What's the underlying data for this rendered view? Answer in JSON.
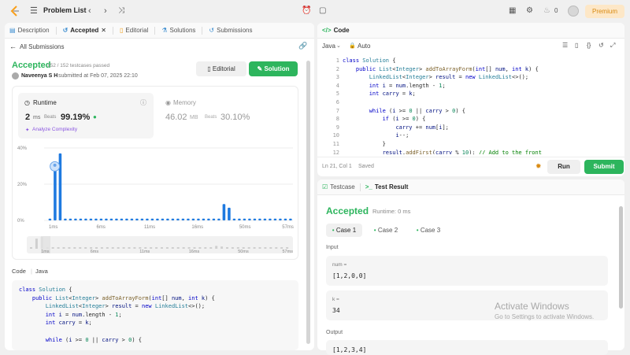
{
  "header": {
    "title": "Problem List",
    "premium": "Premium",
    "notifications": "0"
  },
  "left_tabs": [
    {
      "label": "Description"
    },
    {
      "label": "Accepted"
    },
    {
      "label": "Editorial"
    },
    {
      "label": "Solutions"
    },
    {
      "label": "Submissions"
    }
  ],
  "submission": {
    "back": "All Submissions",
    "status": "Accepted",
    "passed": "152 / 152 testcases passed",
    "user": "Naveenya S H",
    "submitted": "submitted at Feb 07, 2025 22:10",
    "editorial_btn": "Editorial",
    "solution_btn": "Solution"
  },
  "runtime": {
    "label": "Runtime",
    "value": "2",
    "unit": "ms",
    "beats_label": "Beats",
    "beats": "99.19%",
    "analyze": "Analyze Complexity"
  },
  "memory": {
    "label": "Memory",
    "value": "46.02",
    "unit": "MB",
    "beats_label": "Beats",
    "beats": "30.10%"
  },
  "chart_data": {
    "type": "bar",
    "x_ticks": [
      "1ms",
      "6ms",
      "11ms",
      "16ms",
      "50ms",
      "57ms"
    ],
    "y_ticks": [
      "40%",
      "20%",
      "0%"
    ],
    "ylim": [
      0,
      40
    ],
    "values": [
      1,
      32,
      37,
      1,
      1,
      1,
      1,
      1,
      1,
      1,
      1,
      1,
      1,
      1,
      1,
      1,
      1,
      1,
      1,
      1,
      1,
      1,
      1,
      1,
      1,
      1,
      1,
      1,
      1,
      1,
      1,
      1,
      1,
      1,
      9,
      7,
      1,
      1,
      1,
      1,
      1,
      1,
      1,
      1,
      1,
      1,
      1,
      1
    ],
    "highlight_index": 1,
    "mini_ticks": [
      "1ms",
      "6ms",
      "11ms",
      "16ms",
      "50ms",
      "57ms"
    ]
  },
  "left_code": {
    "label": "Code",
    "lang": "Java"
  },
  "editor": {
    "tab": "Code",
    "lang": "Java",
    "mode": "Auto",
    "status": "Ln 21, Col 1",
    "saved": "Saved",
    "run": "Run",
    "submit": "Submit"
  },
  "code_lines": [
    "1",
    "2",
    "3",
    "4",
    "5",
    "6",
    "7",
    "8",
    "9",
    "10",
    "11",
    "12"
  ],
  "result": {
    "tab_testcase": "Testcase",
    "tab_result": "Test Result",
    "status": "Accepted",
    "runtime": "Runtime: 0 ms",
    "cases": [
      "Case 1",
      "Case 2",
      "Case 3"
    ],
    "input_label": "Input",
    "num_label": "num =",
    "num_value": "[1,2,0,0]",
    "k_label": "k =",
    "k_value": "34",
    "output_label": "Output",
    "output_value": "[1,2,3,4]"
  },
  "watermark": {
    "title": "Activate Windows",
    "subtitle": "Go to Settings to activate Windows."
  }
}
